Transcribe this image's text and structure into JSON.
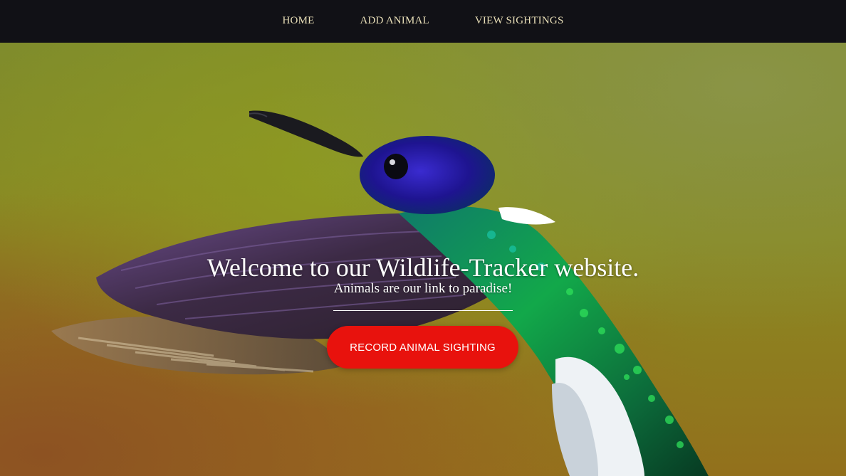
{
  "nav": {
    "items": [
      {
        "label": "HOME"
      },
      {
        "label": "ADD ANIMAL"
      },
      {
        "label": "VIEW SIGHTINGS"
      }
    ]
  },
  "hero": {
    "image_icon": "hummingbird-photo",
    "title": "Welcome to our Wildlife-Tracker website.",
    "subtitle": "Animals are our link to paradise!",
    "cta_label": "RECORD ANIMAL SIGHTING"
  },
  "colors": {
    "navbar_bg": "#111116",
    "nav_text": "#e9dfb8",
    "cta_bg": "#e8120d",
    "hero_text": "#ffffff"
  }
}
